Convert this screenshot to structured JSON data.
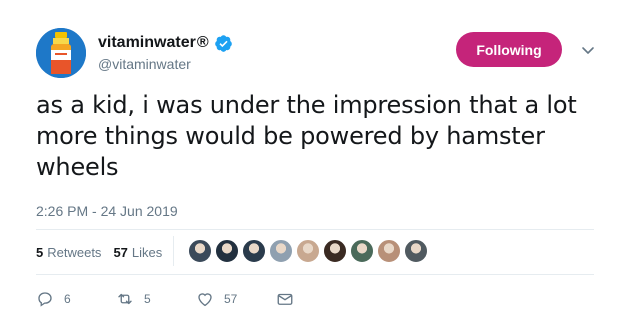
{
  "user": {
    "display_name": "vitaminwater",
    "registered_mark": "®",
    "handle": "@vitaminwater",
    "avatar_icon": "vitaminwater-bottle-logo",
    "verified_icon": "verified-badge-icon"
  },
  "follow_button": {
    "label": "Following",
    "color": "#c5247a"
  },
  "tweet": {
    "text": "as a kid, i was under the impression that a lot more things would be powered by hamster wheels",
    "timestamp": "2:26 PM - 24 Jun 2019"
  },
  "stats": {
    "retweets_count": "5",
    "retweets_label": "Retweets",
    "likes_count": "57",
    "likes_label": "Likes",
    "liker_avatars": [
      "#3b4a5a",
      "#22303f",
      "#2a3b4c",
      "#8fa0b0",
      "#c8a890",
      "#3a2a22",
      "#4a6a5a",
      "#b89078",
      "#505a60"
    ]
  },
  "actions": {
    "reply_count": "6",
    "retweet_count": "5",
    "like_count": "57"
  },
  "colors": {
    "text": "#14171a",
    "muted": "#657786",
    "verified": "#1da1f2",
    "divider": "#e6ecf0"
  }
}
